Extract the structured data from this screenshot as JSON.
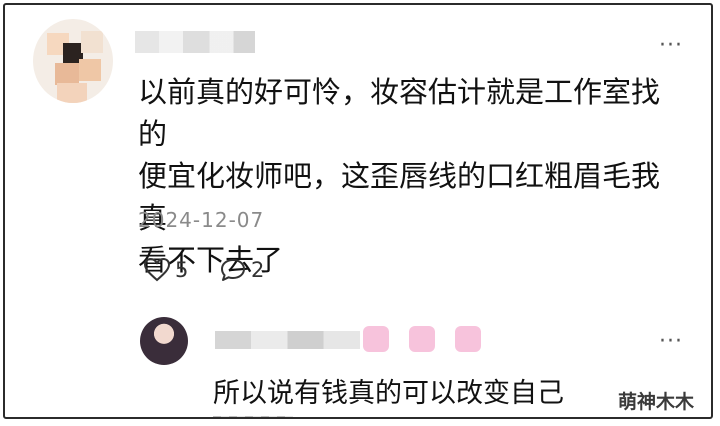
{
  "comment": {
    "lines": [
      "以前真的好可怜，妆容估计就是工作室找的",
      "便宜化妆师吧，这歪唇线的口红粗眉毛我真",
      "看不下去了"
    ],
    "date": "2024-12-07",
    "like_count": "5",
    "reply_count": "2",
    "more_label": "···"
  },
  "reply": {
    "text": "所以说有钱真的可以改变自己",
    "more_label": "···"
  },
  "watermark": "萌神木木",
  "icons": {
    "like": "heart-icon",
    "reply": "speech-bubble-icon",
    "more": "more-dots-icon"
  },
  "colors": {
    "text": "#111111",
    "meta": "#8a8a8a",
    "border": "#2b2b2b",
    "pink_emoji": "#f6b8d6"
  }
}
